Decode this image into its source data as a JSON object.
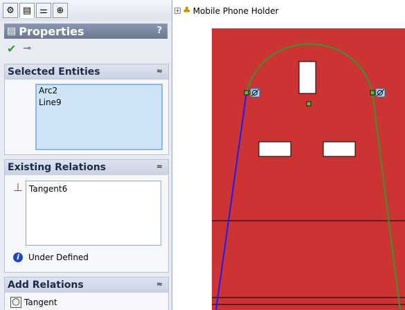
{
  "property_manager": {
    "tabs": [
      "feature-manager",
      "property-manager",
      "configuration-manager",
      "dim-xpert-manager"
    ],
    "title": "Properties",
    "help": "?",
    "selected_entities": {
      "heading": "Selected Entities",
      "items": [
        "Arc2",
        "Line9"
      ]
    },
    "existing_relations": {
      "heading": "Existing Relations",
      "items": [
        "Tangent6"
      ],
      "status": "Under Defined"
    },
    "add_relations": {
      "heading": "Add Relations",
      "items": [
        "Tangent"
      ]
    }
  },
  "graphics": {
    "tree_root": "Mobile Phone Holder",
    "sketch_color": "#cc3333",
    "arc_color": "#2e9b2e",
    "line_color": "#1a1aff"
  }
}
